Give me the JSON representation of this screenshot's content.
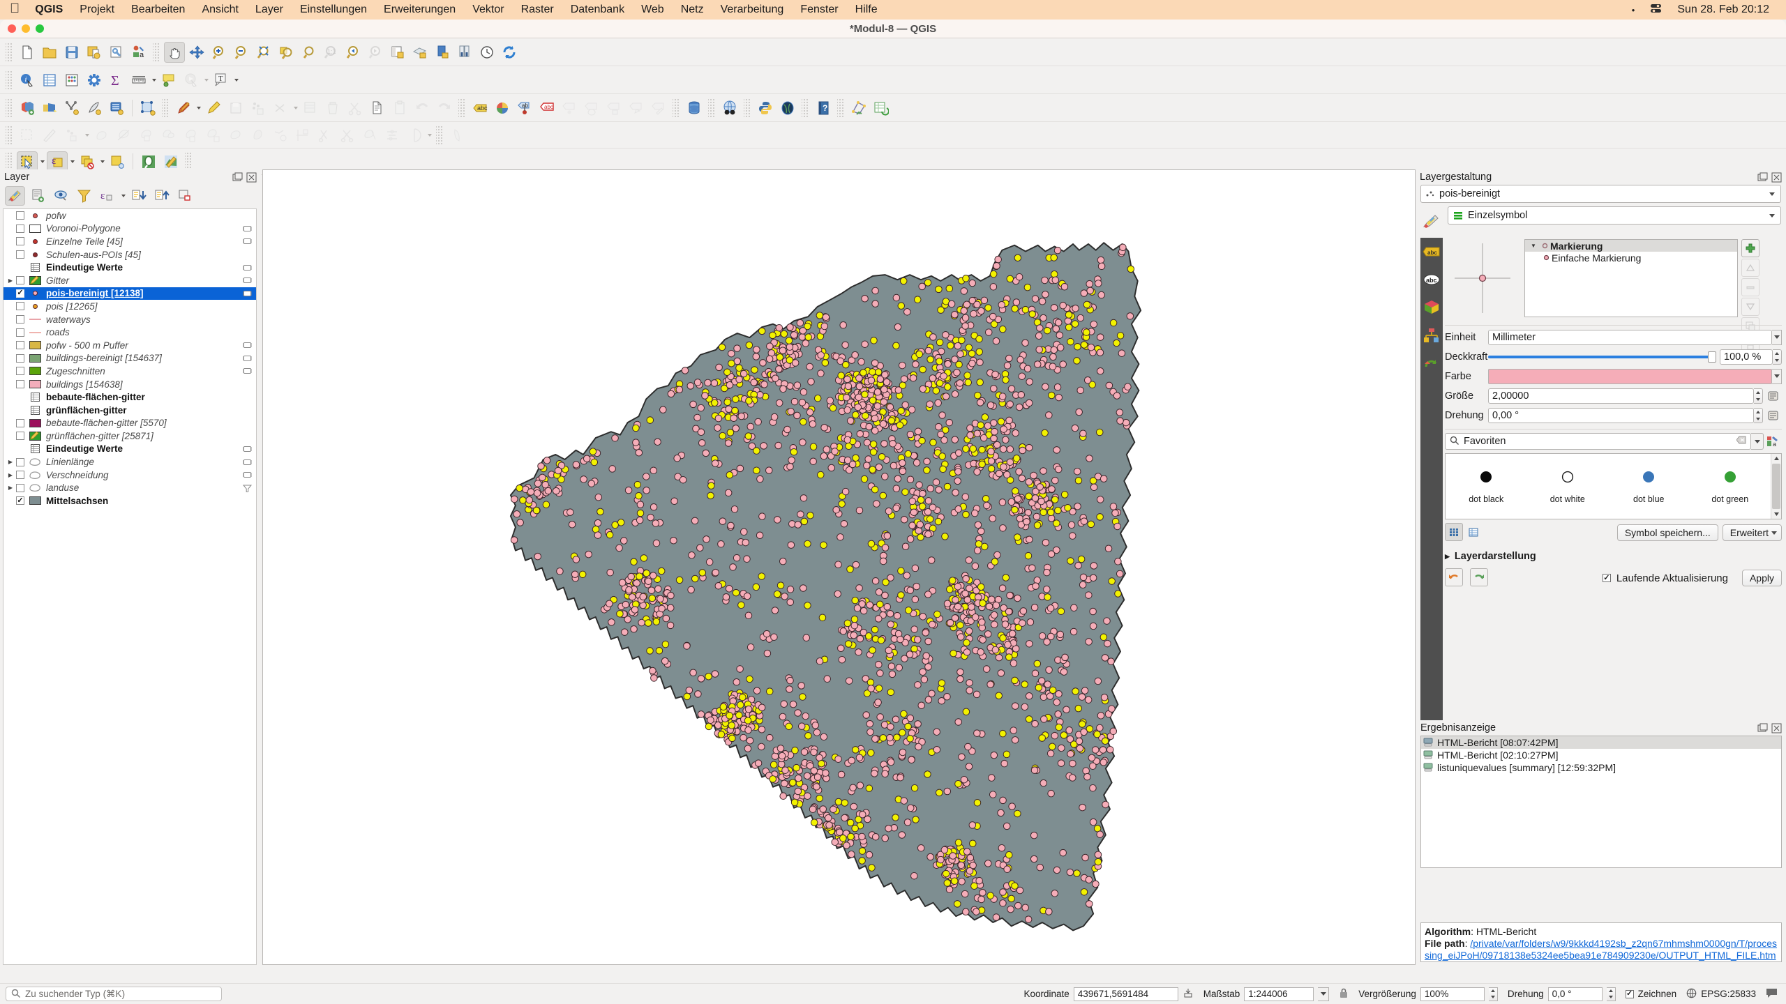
{
  "macbar": {
    "apple_icon": "apple-logo-icon",
    "app_name": "QGIS",
    "menus": [
      "Projekt",
      "Bearbeiten",
      "Ansicht",
      "Layer",
      "Einstellungen",
      "Erweiterungen",
      "Vektor",
      "Raster",
      "Datenbank",
      "Web",
      "Netz",
      "Verarbeitung",
      "Fenster",
      "Hilfe"
    ],
    "status_dot": "•",
    "control_center_icon": "control-center-icon",
    "clock": "Sun 28. Feb  20:12"
  },
  "window": {
    "title": "*Modul-8 — QGIS"
  },
  "toolbars": {
    "row1": [
      "new-project-icon",
      "open-project-icon",
      "save-project-icon",
      "save-project-as-icon",
      "project-properties-icon",
      "style-manager-icon",
      "pan-map-icon",
      "pan-to-selection-icon",
      "zoom-in-icon",
      "zoom-out-icon",
      "zoom-full-icon",
      "zoom-to-selection-icon",
      "zoom-to-layer-icon",
      "zoom-native-icon"
    ],
    "row2": [
      "zoom-to-layer-icon",
      "zoom-to-selection-icon",
      "zoom-native-icon",
      "zoom-last-icon",
      "zoom-next-icon",
      "new-map-view-icon",
      "new-3d-map-view-icon",
      "new-print-layout-icon",
      "layout-manager-icon",
      "temporal-controller-icon",
      "refresh-icon",
      "identify-features-icon",
      "open-attribute-table-icon",
      "field-calculator-icon",
      "processing-toolbox-icon",
      "statistical-summary-icon",
      "measure-line-icon",
      "map-tips-icon",
      "run-feature-action-icon",
      "new-text-annotation-icon"
    ],
    "row3": [
      "add-vector-layer-icon",
      "add-raster-layer-icon",
      "add-delimited-text-layer-icon",
      "add-mesh-layer-icon",
      "add-postgis-layer-icon",
      "add-spatialite-layer-icon",
      "toggle-editing-icon",
      "save-layer-edits-icon",
      "digitize-icon",
      "add-feature-icon",
      "vertex-tool-icon",
      "modify-attributes-icon",
      "delete-selected-icon",
      "cut-features-icon",
      "copy-features-icon",
      "paste-features-icon",
      "undo-icon",
      "redo-icon",
      "label-toolbar-icon",
      "diagram-icon",
      "pin-labels-icon",
      "show-hide-labels-icon",
      "move-label-icon",
      "show-unplaced-labels-icon",
      "rotate-label-icon",
      "change-label-icon",
      "database-manager-icon",
      "metasearch-icon",
      "python-console-icon",
      "globe-plugin-icon",
      "help-contents-icon",
      "georeferencer-icon",
      "refresh-attribute-table-icon"
    ],
    "row4": [
      "advanced-digitizing-icon",
      "measure-angle-icon",
      "offset-curve-icon",
      "reshape-features-icon",
      "split-features-icon",
      "split-parts-icon",
      "merge-features-icon",
      "merge-attributes-icon",
      "delete-ring-icon",
      "delete-part-icon",
      "fill-ring-icon",
      "simplify-feature-icon",
      "rotate-feature-icon",
      "trim-extend-icon",
      "scissors-icon",
      "trim-icon",
      "offset-point-icon",
      "reverse-line-icon",
      "rotate-point-symbols-icon"
    ],
    "row5": [
      "select-features-icon",
      "select-by-expression-icon",
      "deselect-features-icon",
      "select-all-icon",
      "zoom-to-selection-icon",
      "open-field-calculator-icon"
    ]
  },
  "left_panel": {
    "title": "Layer",
    "dock_buttons": [
      "undock-icon",
      "close-icon"
    ],
    "tool_icons": [
      "open-layer-styling-panel-icon",
      "add-group-icon",
      "manage-map-themes-icon",
      "filter-legend-icon",
      "filter-legend-by-expression-icon",
      "expand-all-icon",
      "collapse-all-icon",
      "remove-layer-icon"
    ],
    "layers": [
      {
        "name": "pofw",
        "italic": true,
        "checked": false,
        "symbol": "point",
        "color": "#d45a52",
        "expandable": false,
        "renderer_badge": false,
        "indent": 1
      },
      {
        "name": "Voronoi-Polygone",
        "italic": true,
        "checked": false,
        "symbol": "swatch",
        "color": "#ffffff",
        "expandable": false,
        "renderer_badge": true,
        "indent": 1
      },
      {
        "name": "Einzelne Teile [45]",
        "italic": true,
        "checked": false,
        "symbol": "point",
        "color": "#c4352b",
        "expandable": false,
        "renderer_badge": true,
        "indent": 1
      },
      {
        "name": "Schulen-aus-POIs [45]",
        "italic": true,
        "checked": false,
        "symbol": "point",
        "color": "#8e2b2b",
        "expandable": false,
        "renderer_badge": false,
        "indent": 1
      },
      {
        "name": "Eindeutige Werte",
        "italic": false,
        "group": true,
        "checked": null,
        "symbol": "table",
        "expandable": false,
        "renderer_badge": true,
        "indent": 1
      },
      {
        "name": "Gitter",
        "italic": true,
        "checked": false,
        "symbol": "pencil-edit",
        "expandable": true,
        "renderer_badge": true,
        "indent": 0
      },
      {
        "name": "pois-bereinigt [12138]",
        "italic": false,
        "checked": true,
        "selected": true,
        "symbol": "point",
        "color": "#f5adb8",
        "expandable": false,
        "renderer_badge": true,
        "indent": 1
      },
      {
        "name": "pois [12265]",
        "italic": true,
        "checked": false,
        "symbol": "point",
        "color": "#e8a020",
        "expandable": false,
        "renderer_badge": false,
        "indent": 1
      },
      {
        "name": "waterways",
        "italic": true,
        "checked": false,
        "symbol": "line",
        "color": "#e9a3a8",
        "expandable": false,
        "renderer_badge": false,
        "indent": 1
      },
      {
        "name": "roads",
        "italic": true,
        "checked": false,
        "symbol": "line",
        "color": "#f0b3ae",
        "expandable": false,
        "renderer_badge": false,
        "indent": 1
      },
      {
        "name": "pofw - 500 m Puffer",
        "italic": true,
        "checked": false,
        "symbol": "swatch",
        "color": "#d8b746",
        "expandable": false,
        "renderer_badge": true,
        "indent": 1
      },
      {
        "name": "buildings-bereinigt [154637]",
        "italic": true,
        "checked": false,
        "symbol": "swatch",
        "color": "#7aa472",
        "expandable": false,
        "renderer_badge": true,
        "indent": 1
      },
      {
        "name": "Zugeschnitten",
        "italic": true,
        "checked": false,
        "symbol": "swatch",
        "color": "#5aa40a",
        "expandable": false,
        "renderer_badge": true,
        "indent": 1
      },
      {
        "name": "buildings [154638]",
        "italic": true,
        "checked": false,
        "symbol": "swatch",
        "color": "#f3adbb",
        "expandable": false,
        "renderer_badge": false,
        "indent": 1
      },
      {
        "name": "bebaute-flächen-gitter",
        "italic": false,
        "group": true,
        "checked": null,
        "symbol": "table",
        "expandable": false,
        "renderer_badge": false,
        "indent": 1
      },
      {
        "name": "grünflächen-gitter",
        "italic": false,
        "group": true,
        "checked": null,
        "symbol": "table",
        "expandable": false,
        "renderer_badge": false,
        "indent": 1
      },
      {
        "name": "bebaute-flächen-gitter [5570]",
        "italic": true,
        "checked": false,
        "symbol": "swatch",
        "color": "#9c0f5c",
        "expandable": false,
        "renderer_badge": false,
        "indent": 1
      },
      {
        "name": "grünflächen-gitter [25871]",
        "italic": true,
        "checked": false,
        "symbol": "pencil-edit",
        "color": "#2f9e2f",
        "expandable": false,
        "renderer_badge": false,
        "indent": 1
      },
      {
        "name": "Eindeutige Werte",
        "italic": false,
        "group": true,
        "checked": null,
        "symbol": "table",
        "expandable": false,
        "renderer_badge": true,
        "indent": 1
      },
      {
        "name": "Linienlänge",
        "italic": true,
        "checked": false,
        "symbol": "polygon-outline",
        "expandable": true,
        "renderer_badge": true,
        "indent": 0
      },
      {
        "name": "Verschneidung",
        "italic": true,
        "checked": false,
        "symbol": "polygon-outline",
        "expandable": true,
        "renderer_badge": true,
        "indent": 0
      },
      {
        "name": "landuse",
        "italic": true,
        "checked": false,
        "symbol": "polygon-outline",
        "expandable": true,
        "renderer_badge": false,
        "filter_badge": true,
        "indent": 0
      },
      {
        "name": "Mittelsachsen",
        "italic": false,
        "group": true,
        "checked": true,
        "symbol": "swatch",
        "color": "#7e8e91",
        "expandable": false,
        "renderer_badge": false,
        "indent": 1
      }
    ]
  },
  "map": {
    "polygon_fill": "#7e8e91",
    "polygon_stroke": "#2a2a2a",
    "point_colors": [
      "#f5adb8",
      "#f2f200"
    ],
    "background": "#ffffff"
  },
  "right_panel": {
    "title": "Layergestaltung",
    "dock_buttons": [
      "undock-icon",
      "close-icon"
    ],
    "layer_combo": "pois-bereinigt",
    "renderer_combo": "Einzelsymbol",
    "style_tabs": [
      "labels-icon",
      "masks-icon",
      "3d-view-icon",
      "diagrams-icon",
      "actions-icon"
    ],
    "symbol_layers": [
      {
        "label": "Markierung",
        "level": 0,
        "bold": true
      },
      {
        "label": "Einfache Markierung",
        "level": 1,
        "bold": false
      }
    ],
    "symbol_buttons": [
      "add-symbol-layer-icon",
      "remove-symbol-layer-icon",
      "duplicate-symbol-layer-icon",
      "move-up-icon",
      "move-down-icon",
      "lock-layer-icon"
    ],
    "fields": {
      "unit_label": "Einheit",
      "unit_value": "Millimeter",
      "opacity_label": "Deckkraft",
      "opacity_value": "100,0 %",
      "color_label": "Farbe",
      "color_value": "#f5adb8",
      "size_label": "Größe",
      "size_value": "2,00000",
      "rotation_label": "Drehung",
      "rotation_value": "0,00 °"
    },
    "symbol_search": "Favoriten",
    "symbol_gallery": [
      {
        "label": "dot  black",
        "fill": "#0a0a0a",
        "stroke": "#0a0a0a"
      },
      {
        "label": "dot  white",
        "fill": "#ffffff",
        "stroke": "#1a1a1a"
      },
      {
        "label": "dot blue",
        "fill": "#3a76b8",
        "stroke": "#2a5a8e"
      },
      {
        "label": "dot green",
        "fill": "#35a035",
        "stroke": "#2a7c2a"
      }
    ],
    "view_buttons": [
      "grid-view-icon",
      "list-view-icon"
    ],
    "save_symbol_button": "Symbol speichern...",
    "advanced_button": "Erweitert",
    "layer_rendering_section": "Layerdarstellung",
    "undo_icon": "undo-icon",
    "redo_icon": "redo-icon",
    "live_update_label": "Laufende Aktualisierung",
    "live_update_checked": true,
    "apply_button": "Apply"
  },
  "results_panel": {
    "title": "Ergebnisanzeige",
    "items": [
      {
        "label": "HTML-Bericht [08:07:42PM]",
        "selected": true
      },
      {
        "label": "HTML-Bericht [02:10:27PM]",
        "selected": false
      },
      {
        "label": "listuniquevalues [summary] [12:59:32PM]",
        "selected": false
      }
    ],
    "log": {
      "algorithm_label": "Algorithm",
      "algorithm_value": "HTML-Bericht",
      "filepath_label": "File path",
      "filepath_value": "/private/var/folders/w9/9kkkd4192sb_z2qn67mhmshm0000gn/T/processing_eiJPoH/09718138e5324ee5bea91e784909230e/OUTPUT_HTML_FILE.html"
    }
  },
  "statusbar": {
    "search_placeholder": "Zu suchender Typ (⌘K)",
    "coordinate_label": "Koordinate",
    "coordinate_value": "439671,5691484",
    "scale_label": "Maßstab",
    "scale_value": "1:244006",
    "magnifier_label": "Vergrößerung",
    "magnifier_value": "100%",
    "rotation_label": "Drehung",
    "rotation_value": "0,0 °",
    "render_label": "Zeichnen",
    "render_checked": true,
    "crs_label": "EPSG:25833",
    "lock_icon": "lock-icon",
    "messages_icon": "messages-icon"
  }
}
